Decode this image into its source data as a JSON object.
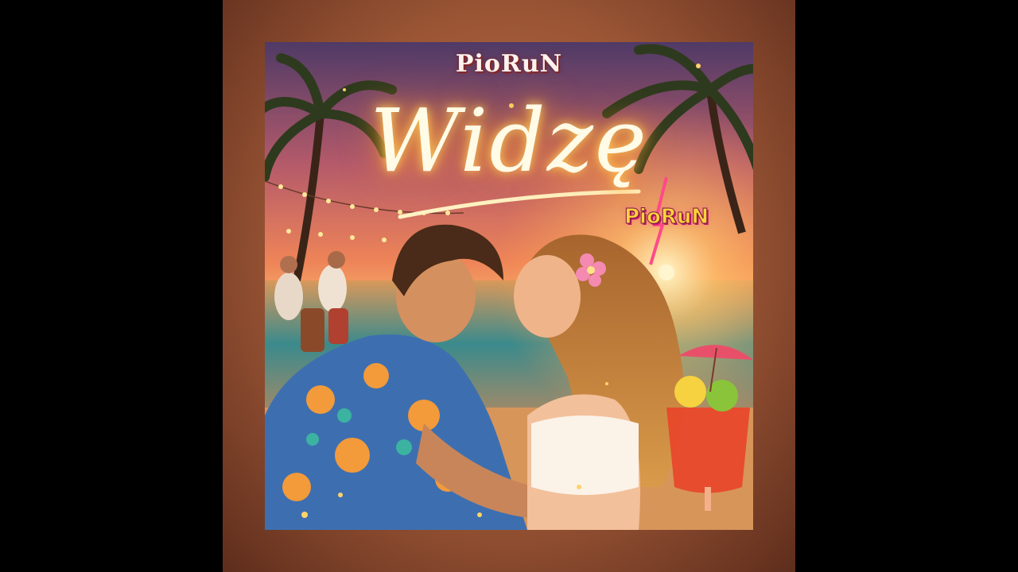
{
  "artwork": {
    "artist_top": "PioRuN",
    "title": "Widzę",
    "artist_badge": "PioRuN",
    "colors": {
      "sky_top": "#5a3b6a",
      "sky_mid": "#e8785a",
      "sun": "#fff1b0",
      "sea": "#2f7f8a",
      "sand": "#e7a25c"
    }
  }
}
